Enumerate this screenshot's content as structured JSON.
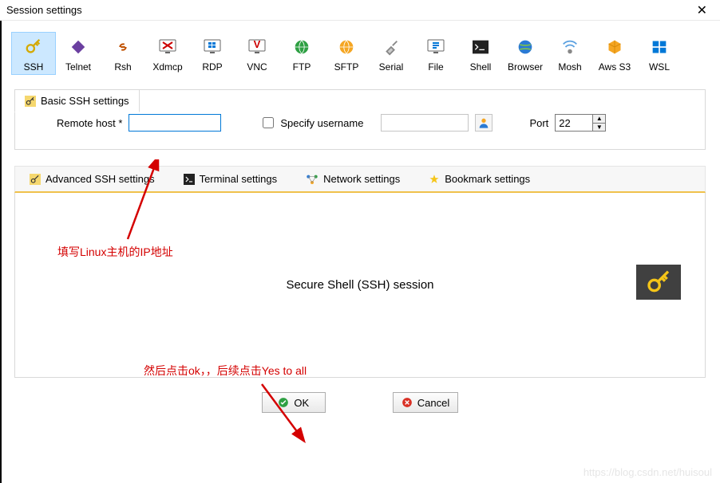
{
  "window": {
    "title": "Session settings"
  },
  "protocols": [
    {
      "label": "SSH"
    },
    {
      "label": "Telnet"
    },
    {
      "label": "Rsh"
    },
    {
      "label": "Xdmcp"
    },
    {
      "label": "RDP"
    },
    {
      "label": "VNC"
    },
    {
      "label": "FTP"
    },
    {
      "label": "SFTP"
    },
    {
      "label": "Serial"
    },
    {
      "label": "File"
    },
    {
      "label": "Shell"
    },
    {
      "label": "Browser"
    },
    {
      "label": "Mosh"
    },
    {
      "label": "Aws S3"
    },
    {
      "label": "WSL"
    }
  ],
  "basic": {
    "tab_label": "Basic SSH settings",
    "remote_host_label": "Remote host *",
    "remote_host_value": "",
    "specify_user_label": "Specify username",
    "specify_user_checked": false,
    "username_value": "",
    "port_label": "Port",
    "port_value": "22"
  },
  "adv_tabs": {
    "ssh": "Advanced SSH settings",
    "terminal": "Terminal settings",
    "network": "Network settings",
    "bookmark": "Bookmark settings"
  },
  "content": {
    "session_label": "Secure Shell (SSH) session"
  },
  "buttons": {
    "ok": "OK",
    "cancel": "Cancel"
  },
  "annotations": {
    "a1": "填写Linux主机的IP地址",
    "a2": "然后点击ok，，后续点击Yes to all"
  },
  "watermark": "https://blog.csdn.net/huisoul"
}
